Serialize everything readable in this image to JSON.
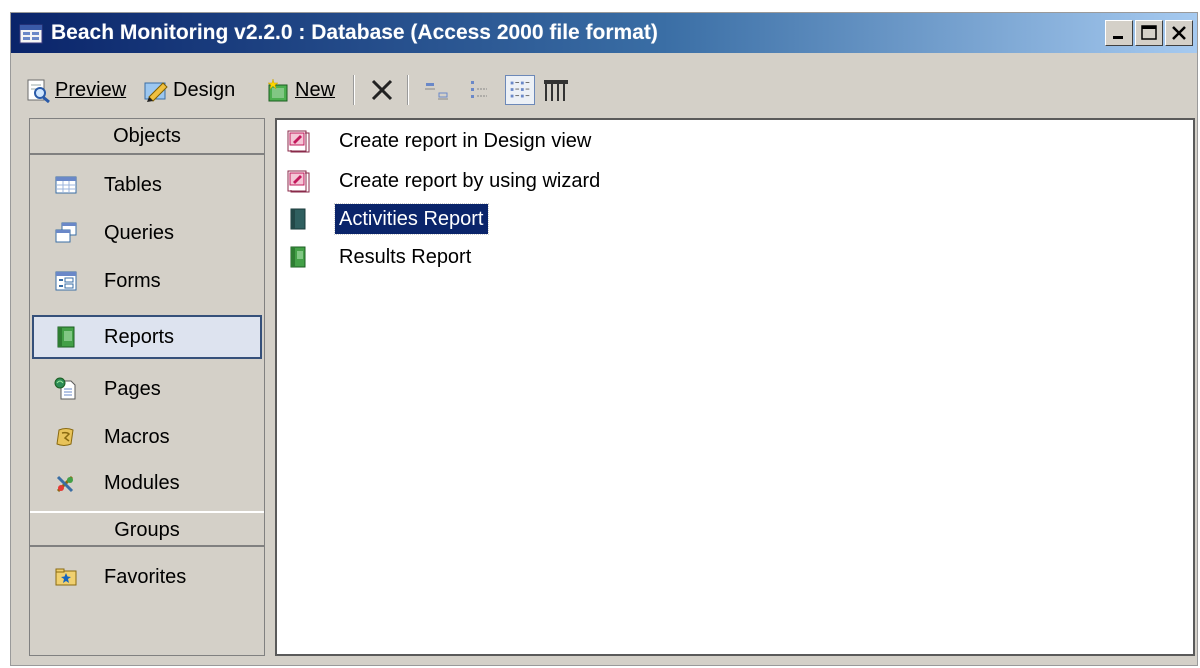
{
  "window": {
    "title_prefix": "Beach Monitoring ",
    "title_rest": "v2.2.0 : Database (Access 2000 file format)",
    "controls": [
      "minimize",
      "maximize",
      "close"
    ]
  },
  "toolbar": {
    "preview_label": "Preview",
    "design_label": "Design",
    "new_label": "New",
    "icons": [
      "preview-icon",
      "design-icon",
      "new-icon",
      "delete-icon",
      "large-icons-view-icon",
      "small-icons-view-icon",
      "list-view-icon",
      "details-view-icon"
    ]
  },
  "objects_bar": {
    "objects_header": "Objects",
    "items": [
      {
        "label": "Tables",
        "icon": "table-icon"
      },
      {
        "label": "Queries",
        "icon": "query-icon"
      },
      {
        "label": "Forms",
        "icon": "form-icon"
      },
      {
        "label": "Reports",
        "icon": "report-icon",
        "selected": true
      },
      {
        "label": "Pages",
        "icon": "page-icon"
      },
      {
        "label": "Macros",
        "icon": "macro-icon"
      },
      {
        "label": "Modules",
        "icon": "module-icon"
      }
    ],
    "groups_header": "Groups",
    "groups": [
      {
        "label": "Favorites",
        "icon": "favorites-folder-icon"
      }
    ]
  },
  "list": {
    "items": [
      {
        "label": "Create report in Design view",
        "icon": "create-shortcut-icon"
      },
      {
        "label": "Create report by using wizard",
        "icon": "create-shortcut-icon"
      },
      {
        "label": "Activities Report",
        "icon": "report-icon",
        "selected": true
      },
      {
        "label": "Results Report",
        "icon": "report-icon"
      }
    ]
  },
  "colors": {
    "title_gradient_start": "#0a246a",
    "title_gradient_end": "#a6caf0",
    "selection": "#0a246a",
    "window_face": "#d4d0c8"
  }
}
